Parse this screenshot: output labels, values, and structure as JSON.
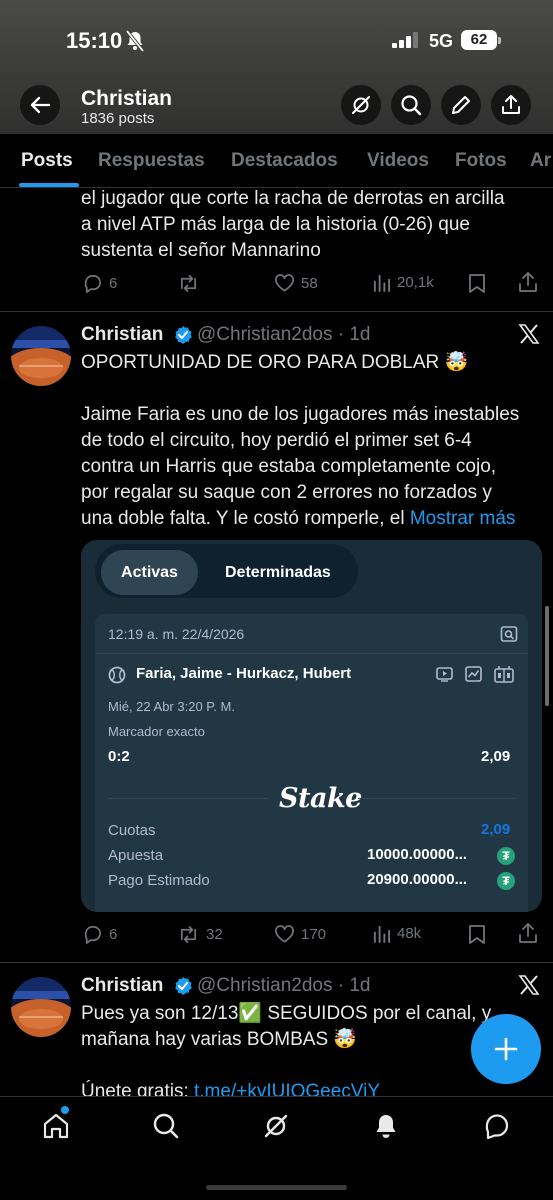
{
  "status_bar": {
    "time": "15:10",
    "network": "5G",
    "battery": "62"
  },
  "header": {
    "name": "Christian",
    "posts_count": "1836 posts"
  },
  "tabs": [
    {
      "label": "Posts"
    },
    {
      "label": "Respuestas"
    },
    {
      "label": "Destacados"
    },
    {
      "label": "Videos"
    },
    {
      "label": "Fotos"
    },
    {
      "label": "Ar"
    }
  ],
  "tweet1": {
    "text_lines": [
      "el jugador que corte la racha de derrotas en arcilla",
      "a nivel ATP más larga de la historia (0-26) que",
      "sustenta el señor Mannarino"
    ],
    "replies": "6",
    "likes": "58",
    "views": "20,1k"
  },
  "tweet2": {
    "name": "Christian",
    "handle": "@Christian2dos",
    "time": "1d",
    "headline": "OPORTUNIDAD DE ORO PARA DOBLAR 🤯",
    "body_lines": [
      "Jaime Faria es uno de los jugadores más inestables",
      "de todo el circuito, hoy perdió el primer set 6-4",
      "contra un Harris que estaba completamente cojo,",
      "por regalar su saque con 2 errores no forzados y",
      "una doble falta. Y le costó romperle, el"
    ],
    "show_more": "Mostrar más",
    "replies": "6",
    "reposts": "32",
    "likes": "170",
    "views": "48k"
  },
  "bet_card": {
    "tab_active": "Activas",
    "tab_settled": "Determinadas",
    "datetime": "12:19 a. m. 22/4/2026",
    "match": "Faria, Jaime - Hurkacz, Hubert",
    "match_time": "Mié, 22 Abr   3:20 P. M.",
    "market": "Marcador exacto",
    "selection": "0:2",
    "selection_odds": "2,09",
    "brand": "Stake",
    "odds_label": "Cuotas",
    "odds_value": "2,09",
    "stake_label": "Apuesta",
    "stake_value": "10000.00000...",
    "payout_label": "Pago Estimado",
    "payout_value": "20900.00000...",
    "currency_symbol": "₮"
  },
  "tweet3": {
    "name": "Christian",
    "handle": "@Christian2dos",
    "time": "1d",
    "line1": "Pues ya son 12/13✅ SEGUIDOS por el canal, y",
    "line2": "mañana hay varias BOMBAS 🤯",
    "line3_prefix": "Únete gratis: ",
    "line3_link": "t.me/+kvIUIQGeecViY"
  },
  "colors": {
    "accent": "#1d9bf0",
    "stake_bg": "#1a2c38",
    "stake_blue": "#1475e1"
  }
}
